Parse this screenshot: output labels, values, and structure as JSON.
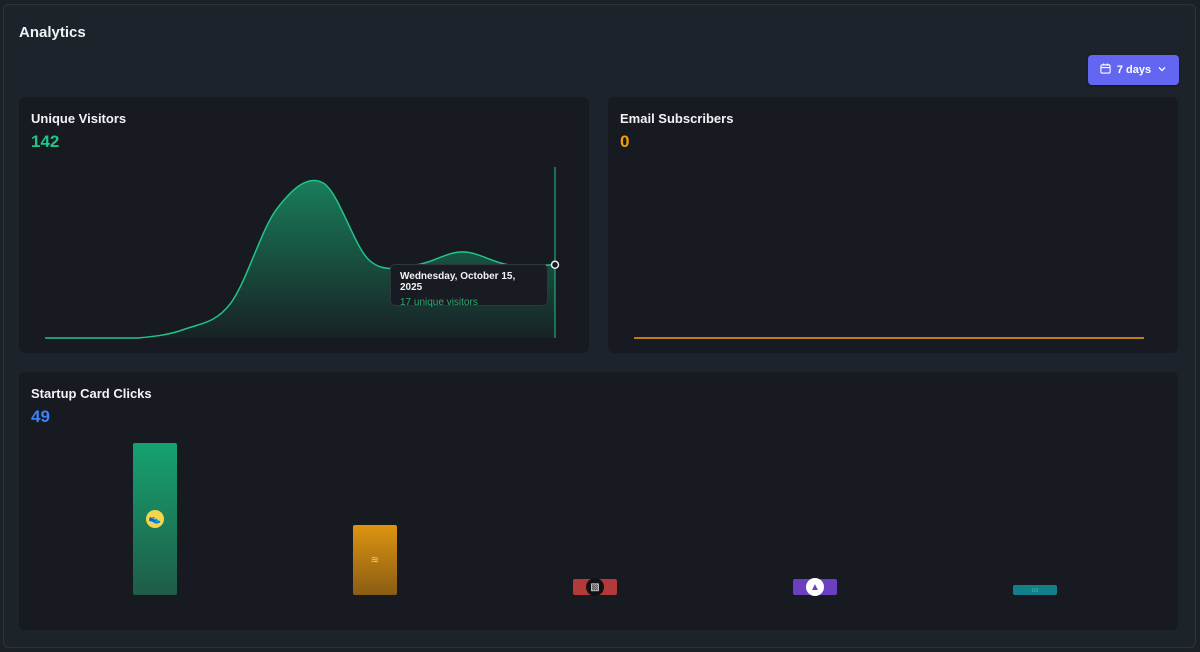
{
  "page": {
    "title": "Analytics"
  },
  "date_range": {
    "label": "7 days",
    "icon": "calendar-icon",
    "chevron": "chevron-down-icon"
  },
  "colors": {
    "green": "#22c389",
    "orange": "#f59e0b",
    "blue": "#3b82f6",
    "accent": "#6366f1"
  },
  "unique_visitors": {
    "title": "Unique Visitors",
    "value": "142",
    "tooltip": {
      "date": "Wednesday, October 15, 2025",
      "value": "17 unique visitors"
    }
  },
  "email_subscribers": {
    "title": "Email Subscribers",
    "value": "0"
  },
  "startup_clicks": {
    "title": "Startup Card Clicks",
    "value": "49"
  },
  "chart_data": [
    {
      "type": "area",
      "series": [
        {
          "values": [
            0,
            0,
            0,
            2,
            8,
            30,
            36,
            18,
            17,
            20,
            17,
            17
          ]
        }
      ]
    },
    {
      "type": "line",
      "series": [
        {
          "values": [
            0,
            0,
            0,
            0,
            0,
            0,
            0
          ]
        }
      ]
    },
    {
      "type": "bar",
      "categories": [
        "startup-1",
        "startup-2",
        "startup-3",
        "startup-4",
        "startup-5"
      ],
      "values": [
        24,
        11,
        2.5,
        2.5,
        1.5
      ],
      "bar_colors": [
        "#1a9e6e",
        "#d9900f",
        "#b33a3a",
        "#6a3fc0",
        "#127f8a"
      ],
      "icons": [
        "shoe-icon",
        "stack-icon",
        "broken-image-icon",
        "logo-a-icon",
        "link-icon"
      ]
    }
  ]
}
